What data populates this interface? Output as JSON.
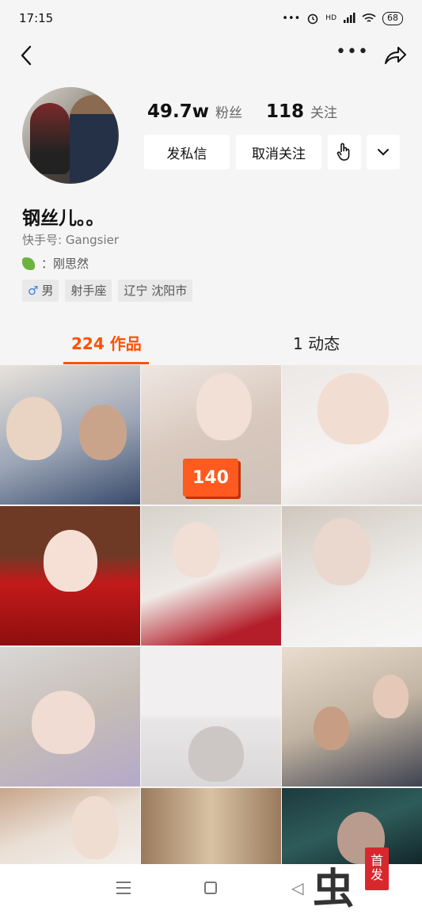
{
  "status_bar": {
    "time": "17:15",
    "signal_dots": "•••",
    "network": "HD",
    "battery": "68"
  },
  "profile": {
    "fans_count": "49.7w",
    "fans_label": "粉丝",
    "following_count": "118",
    "following_label": "关注",
    "name": "钢丝儿。。",
    "account_id": "快手号: Gangsier",
    "signature": "：刚思然",
    "tags": [
      {
        "icon": "male-icon",
        "label": "男"
      },
      {
        "label": "射手座"
      },
      {
        "label": "辽宁 沈阳市"
      }
    ]
  },
  "actions": {
    "message_label": "发私信",
    "unfollow_label": "取消关注"
  },
  "tabs": [
    {
      "label": "224 作品",
      "active": true
    },
    {
      "label": "1 动态",
      "active": false
    }
  ],
  "grid": {
    "badge_count": "140"
  },
  "colors": {
    "accent": "#ff5000",
    "background": "#f5f5f5"
  },
  "watermark": {
    "char": "虫",
    "seal": "首发"
  }
}
